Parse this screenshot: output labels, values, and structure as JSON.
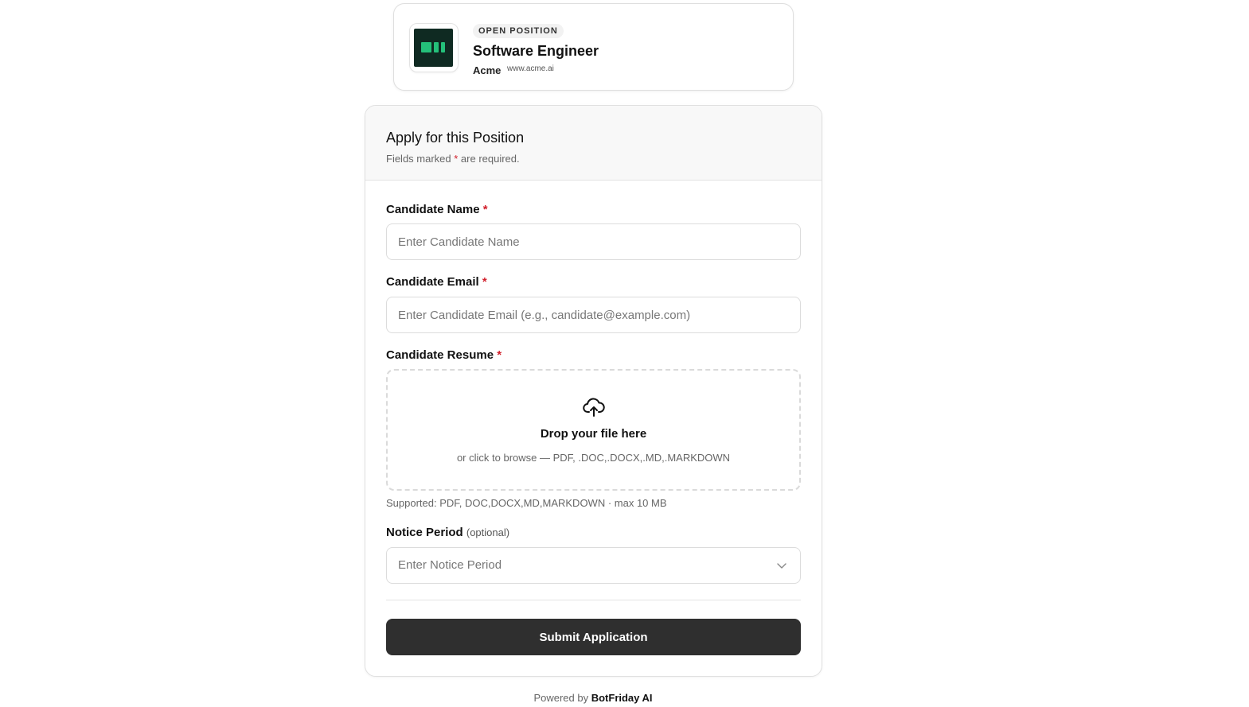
{
  "job": {
    "badge": "OPEN POSITION",
    "title": "Software Engineer",
    "company": "Acme",
    "website": "www.acme.ai",
    "logo_icon": "company-logo"
  },
  "form": {
    "title": "Apply for this Position",
    "subtitle_prefix": "Fields marked ",
    "required_mark": "*",
    "subtitle_suffix": " are required.",
    "fields": {
      "name": {
        "label": "Candidate Name",
        "placeholder": "Enter Candidate Name",
        "value": ""
      },
      "email": {
        "label": "Candidate Email",
        "placeholder": "Enter Candidate Email (e.g., candidate@example.com)",
        "value": ""
      },
      "resume": {
        "label": "Candidate Resume",
        "icon": "cloud-upload-icon",
        "drop_title": "Drop your file here",
        "drop_sub": "or click to browse — PDF, .DOC,.DOCX,.MD,.MARKDOWN",
        "supported": "Supported: PDF, DOC,DOCX,MD,MARKDOWN · max 10 MB"
      },
      "notice": {
        "label": "Notice Period",
        "optional": "(optional)",
        "placeholder": "Enter Notice Period"
      }
    },
    "submit_label": "Submit Application"
  },
  "footer": {
    "prefix": "Powered by ",
    "brand": "BotFriday AI"
  },
  "colors": {
    "required": "#d11f2b",
    "submit_bg": "#2f2f2f",
    "logo_bg": "#0f2a22",
    "logo_accent": "#24c07a"
  }
}
